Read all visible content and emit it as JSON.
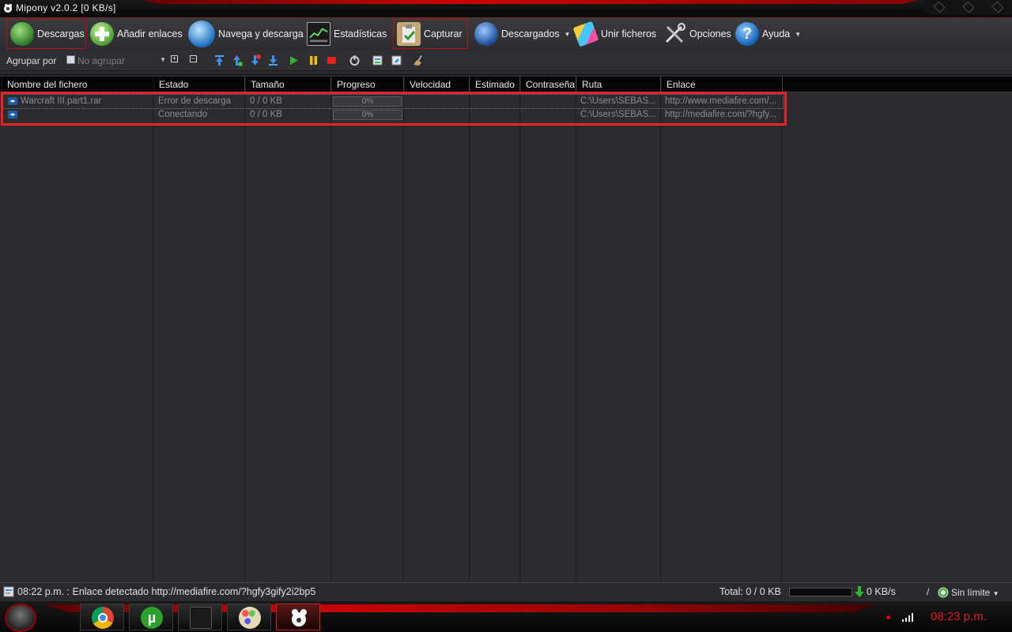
{
  "window": {
    "title": "Mipony v2.0.2 [0 KB/s]"
  },
  "toolbar": {
    "descargas": "Descargas",
    "anadir": "Añadir enlaces",
    "navega": "Navega y descarga",
    "estadisticas": "Estadísticas",
    "capturar": "Capturar",
    "descargados": "Descargados",
    "unir": "Unir ficheros",
    "opciones": "Opciones",
    "ayuda": "Ayuda"
  },
  "toolbar2": {
    "group_label": "Agrupar por",
    "group_value": "No agrupar"
  },
  "columns": [
    "Nombre del fichero",
    "Estado",
    "Tamaño",
    "Progreso",
    "Velocidad",
    "Estimado",
    "Contraseña",
    "Ruta",
    "Enlace"
  ],
  "rows": [
    {
      "name": "Warcraft III.part1.rar",
      "status": "Error de descarga",
      "size": "0 / 0 KB",
      "progress": "0%",
      "speed": "",
      "eta": "",
      "password": "",
      "path": "C:\\Users\\SEBAS...",
      "link": "http://www.mediafire.com/..."
    },
    {
      "name": "",
      "status": "Conectando",
      "size": "0 / 0 KB",
      "progress": "0%",
      "speed": "",
      "eta": "",
      "password": "",
      "path": "C:\\Users\\SEBAS...",
      "link": "http://mediafire.com/?hgfy..."
    }
  ],
  "status": {
    "message": "08:22 p.m. : Enlace detectado http://mediafire.com/?hgfy3gify2i2bp5",
    "total": "Total: 0 / 0 KB",
    "speed": "0 KB/s",
    "slash": "/",
    "limit": "Sin límite"
  },
  "taskbar": {
    "clock": "08:23 p.m."
  },
  "colors": {
    "accent_red": "#e8212a",
    "background": "#2b2b2d"
  }
}
